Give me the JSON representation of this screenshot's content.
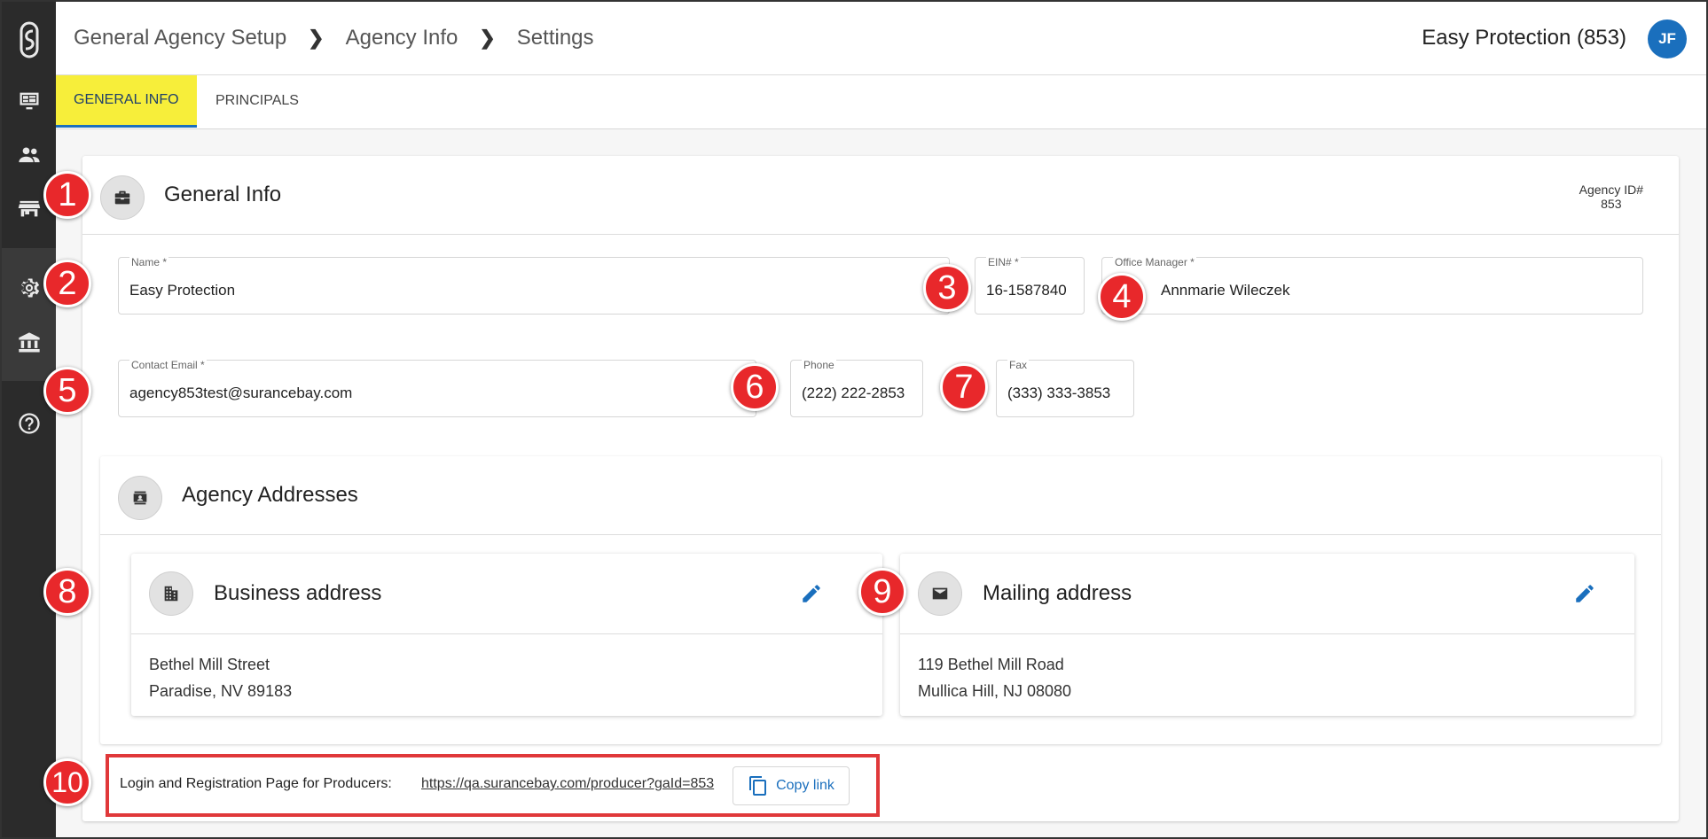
{
  "sidebar": {
    "items": [
      {
        "icon": "logo-icon"
      },
      {
        "icon": "dashboard-monitor-icon"
      },
      {
        "icon": "people-icon"
      },
      {
        "icon": "store-icon"
      },
      {
        "icon": "gear-icon"
      },
      {
        "icon": "bank-icon"
      },
      {
        "icon": "help-icon"
      }
    ]
  },
  "header": {
    "breadcrumb": [
      "General Agency Setup",
      "Agency Info",
      "Settings"
    ],
    "agency_name": "Easy Protection (853)",
    "avatar_initials": "JF"
  },
  "tabs": [
    {
      "label": "GENERAL INFO",
      "active": true
    },
    {
      "label": "PRINCIPALS",
      "active": false
    }
  ],
  "general_info": {
    "title": "General Info",
    "agency_id_label": "Agency ID#",
    "agency_id_value": "853",
    "fields": {
      "name": {
        "label": "Name *",
        "value": "Easy Protection"
      },
      "ein": {
        "label": "EIN# *",
        "value": "16-1587840"
      },
      "office_manager": {
        "label": "Office Manager *",
        "value": "Annmarie Wileczek"
      },
      "contact_email": {
        "label": "Contact Email *",
        "value": "agency853test@surancebay.com"
      },
      "phone": {
        "label": "Phone",
        "value": "(222) 222-2853"
      },
      "fax": {
        "label": "Fax",
        "value": "(333) 333-3853"
      }
    }
  },
  "addresses": {
    "title": "Agency Addresses",
    "business": {
      "title": "Business address",
      "line1": "Bethel Mill Street",
      "line2": "Paradise, NV 89183"
    },
    "mailing": {
      "title": "Mailing address",
      "line1": "119 Bethel Mill Road",
      "line2": "Mullica Hill, NJ 08080"
    }
  },
  "producer_link": {
    "label": "Login and Registration Page for Producers:",
    "url": "https://qa.surancebay.com/producer?gaId=853",
    "copy_label": "Copy link"
  },
  "callouts": [
    "1",
    "2",
    "3",
    "4",
    "5",
    "6",
    "7",
    "8",
    "9",
    "10"
  ],
  "colors": {
    "accent": "#1a6fbd",
    "active_tab": "#f7ee3a",
    "callout": "#e8282b",
    "sidebar": "#2b2b2b"
  }
}
